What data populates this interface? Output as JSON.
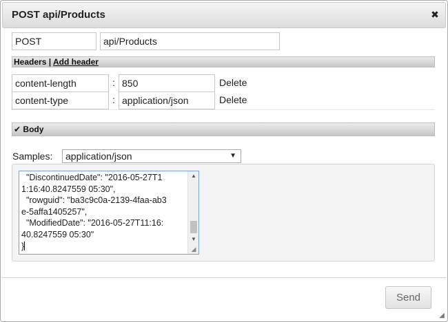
{
  "dialog": {
    "title": "POST api/Products",
    "close_glyph": "✖"
  },
  "request": {
    "method": "POST",
    "uri": "api/Products"
  },
  "headers_section": {
    "label": "Headers",
    "separator": "|",
    "add_header": "Add header",
    "colon": ":",
    "rows": [
      {
        "name": "content-length",
        "value": "850",
        "delete": "Delete"
      },
      {
        "name": "content-type",
        "value": "application/json",
        "delete": "Delete"
      }
    ]
  },
  "body_section": {
    "check": "✔",
    "label": "Body",
    "samples_label": "Samples:",
    "samples_selected": "application/json",
    "text": "  \"DiscontinuedDate\": \"2016-05-27T1\n1:16:40.8247559 05:30\",\n  \"rowguid\": \"ba3c9c0a-2139-4faa-ab3\ne-5affa1405257\",\n  \"ModifiedDate\": \"2016-05-27T11:16:\n40.8247559 05:30\"\n}"
  },
  "footer": {
    "send_label": "Send"
  },
  "icons": {
    "close": "close-icon",
    "dropdown": "chevron-down-icon",
    "scroll_up": "triangle-up-icon",
    "scroll_down": "triangle-down-icon",
    "resize": "resize-grip-icon",
    "checkmark": "check-icon"
  }
}
